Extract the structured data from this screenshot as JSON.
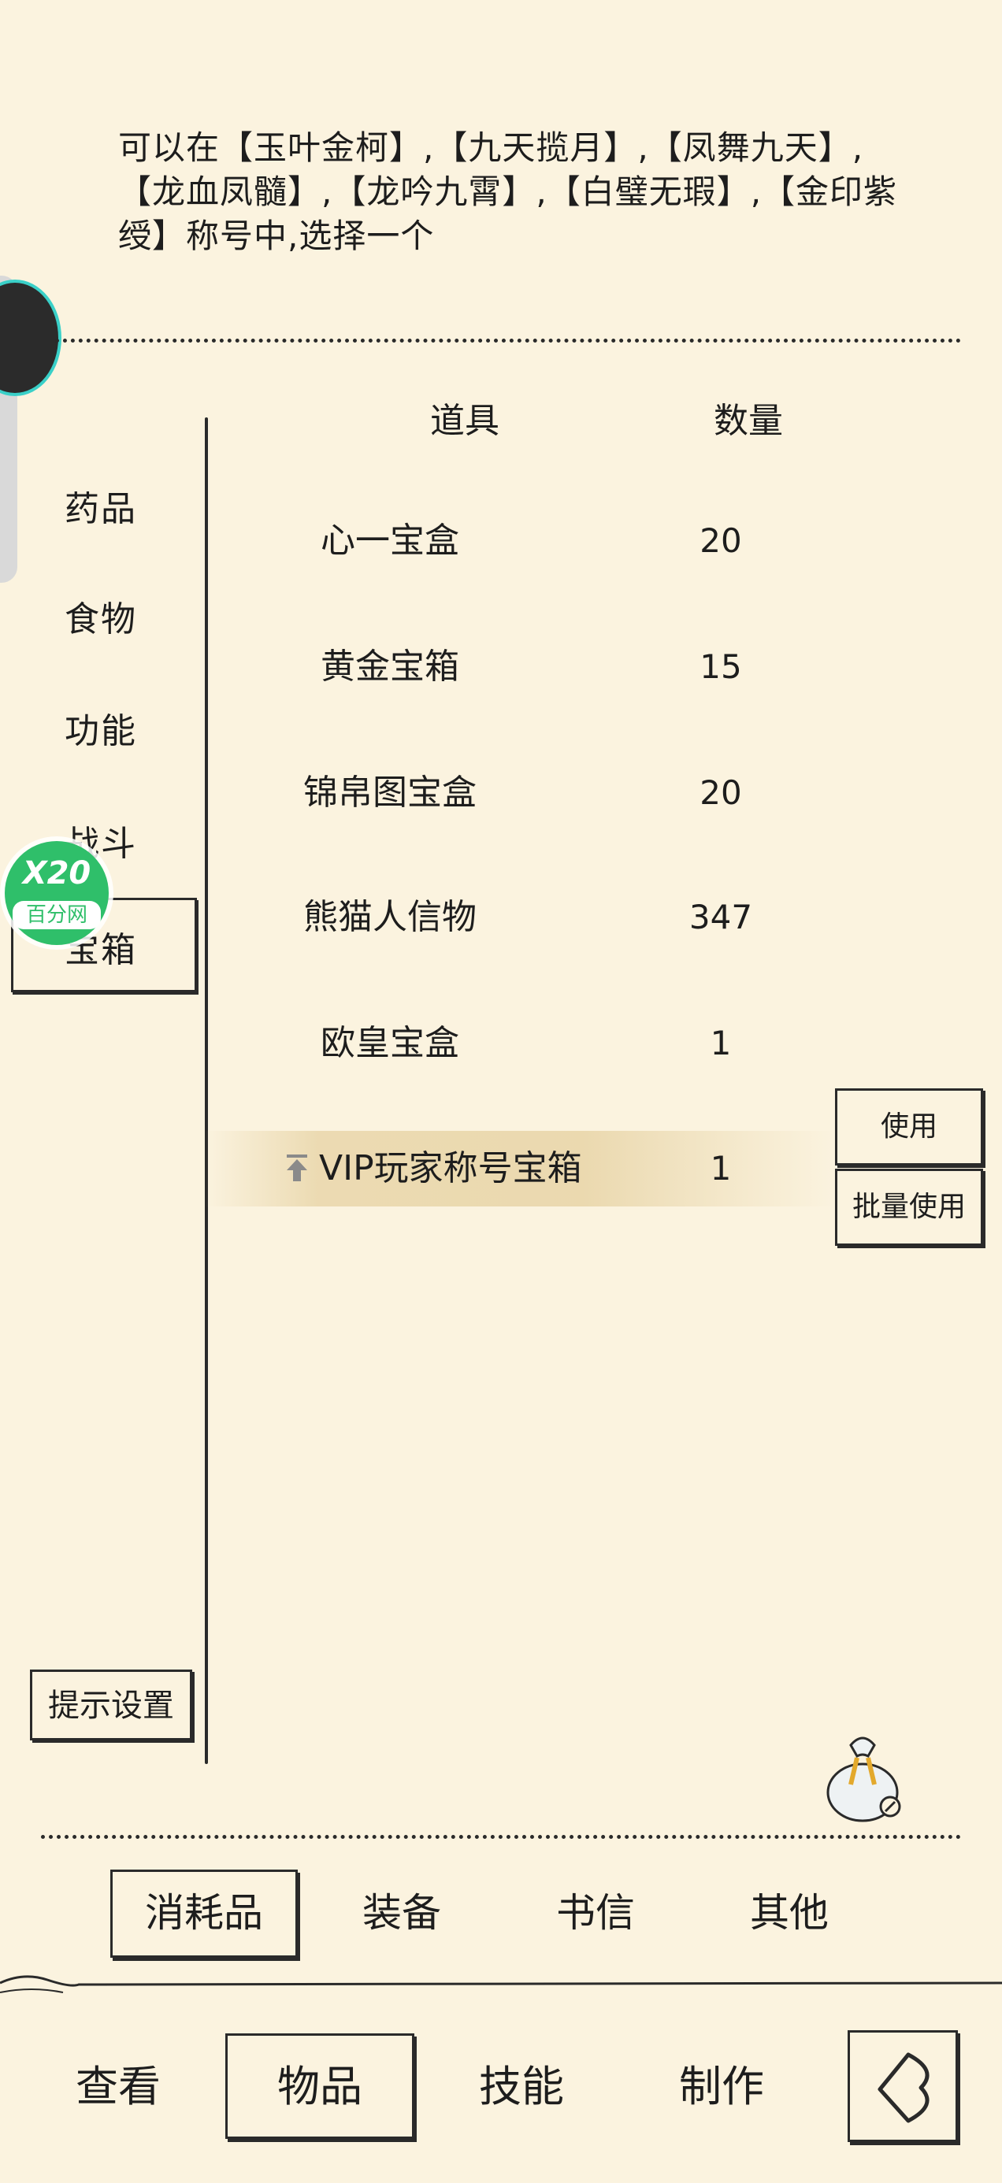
{
  "description": "可以在【玉叶金柯】,【九天揽月】,【凤舞九天】,【龙血凤髓】,【龙吟九霄】,【白璧无瑕】,【金印紫绶】称号中,选择一个",
  "table": {
    "header_item": "道具",
    "header_qty": "数量",
    "rows": [
      {
        "name": "心一宝盒",
        "qty": "20"
      },
      {
        "name": "黄金宝箱",
        "qty": "15"
      },
      {
        "name": "锦帛图宝盒",
        "qty": "20"
      },
      {
        "name": "熊猫人信物",
        "qty": "347"
      },
      {
        "name": "欧皇宝盒",
        "qty": "1"
      },
      {
        "name": "VIP玩家称号宝箱",
        "qty": "1"
      }
    ]
  },
  "categories": [
    "药品",
    "食物",
    "功能",
    "战斗",
    "宝箱"
  ],
  "selected_category": "宝箱",
  "actions": {
    "use": "使用",
    "batch_use": "批量使用"
  },
  "hint_settings": "提示设置",
  "tabs": [
    "消耗品",
    "装备",
    "书信",
    "其他"
  ],
  "selected_tab": "消耗品",
  "nav": [
    "查看",
    "物品",
    "技能",
    "制作"
  ],
  "selected_nav": "物品",
  "watermark": {
    "badge": "X20",
    "site": "百分网"
  },
  "icons": {
    "upgrade": "arrow-up-icon",
    "bag": "money-bag-icon",
    "back": "back-arrow-icon"
  }
}
